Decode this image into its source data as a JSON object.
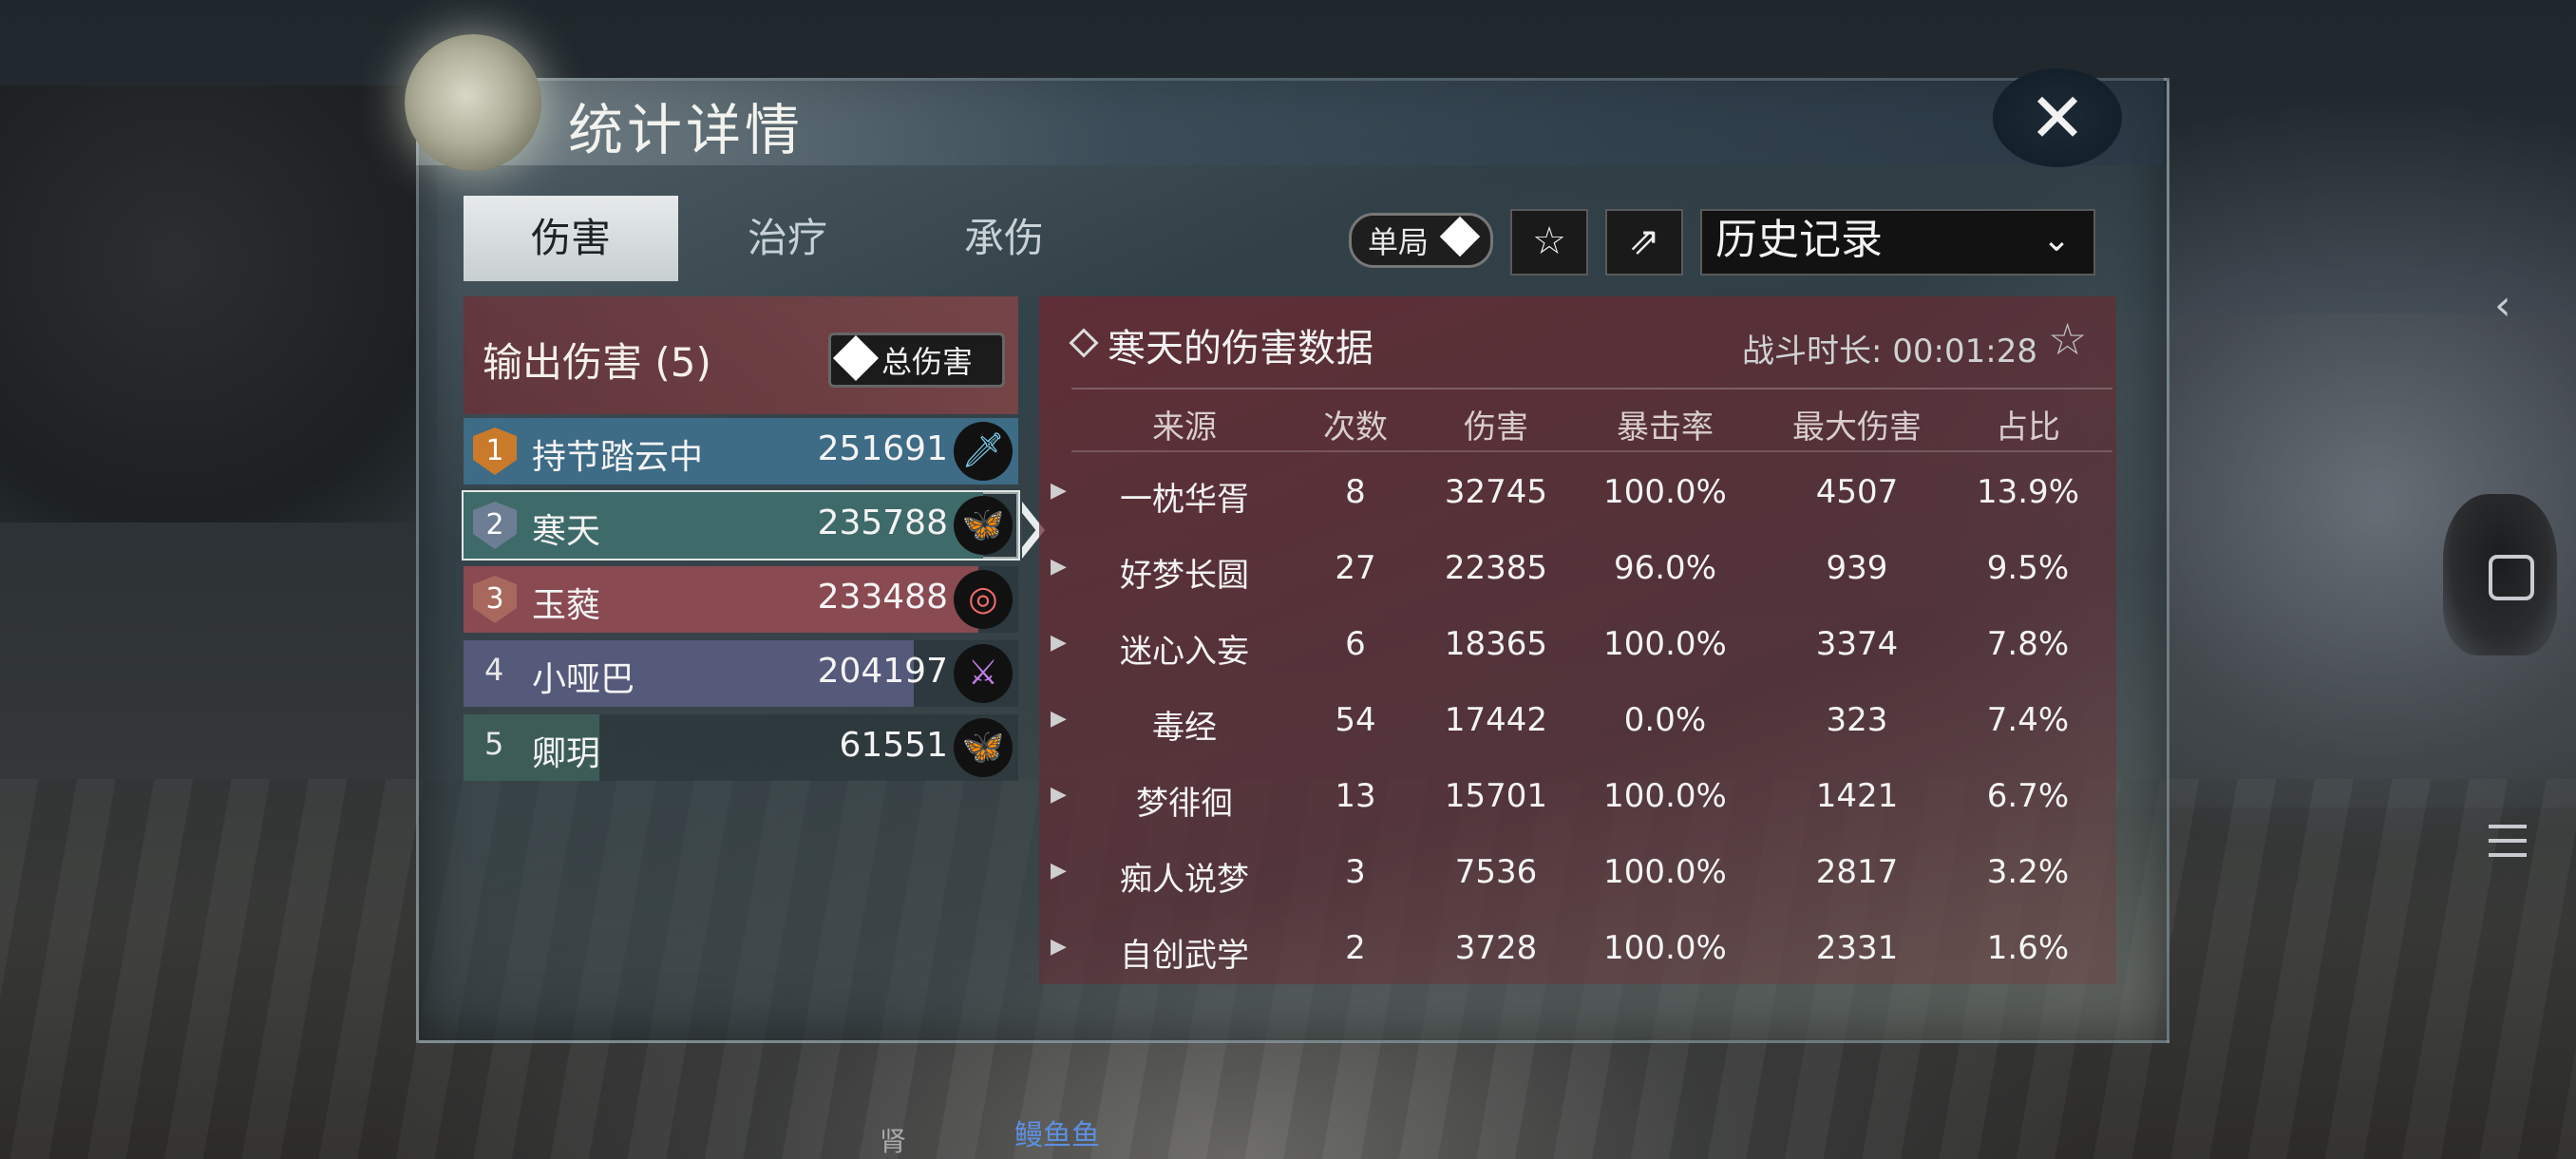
{
  "dialog": {
    "title": "统计详情",
    "close_icon": "✕"
  },
  "tabs": [
    {
      "label": "伤害",
      "active": true
    },
    {
      "label": "治疗",
      "active": false
    },
    {
      "label": "承伤",
      "active": false
    }
  ],
  "toolbar": {
    "mode_label": "单局",
    "history_label": "历史记录"
  },
  "ranking": {
    "title": "输出伤害 (5)",
    "filter_label": "总伤害",
    "rows": [
      {
        "rank": "1",
        "name": "持节踏云中",
        "value": "251691",
        "share": 1.0,
        "fill": "#3e6b86",
        "medal": "#c97a2b",
        "icon": "sword-icon",
        "icon_color": "#7fd0f0",
        "selected": false
      },
      {
        "rank": "2",
        "name": "寒天",
        "value": "235788",
        "share": 0.937,
        "fill": "#3f6a6a",
        "medal": "#6d7e94",
        "icon": "butterfly-icon",
        "icon_color": "#7fe0d0",
        "selected": true
      },
      {
        "rank": "3",
        "name": "玉蕤",
        "value": "233488",
        "share": 0.928,
        "fill": "#8a4a52",
        "medal": "#a8685e",
        "icon": "target-icon",
        "icon_color": "#f06a6a",
        "selected": false
      },
      {
        "rank": "4",
        "name": "小哑巴",
        "value": "204197",
        "share": 0.811,
        "fill": "#55597a",
        "medal": "",
        "icon": "crossed-blades-icon",
        "icon_color": "#c07de8",
        "selected": false
      },
      {
        "rank": "5",
        "name": "卿玥",
        "value": "61551",
        "share": 0.245,
        "fill": "#3d5c58",
        "medal": "",
        "icon": "butterfly-icon",
        "icon_color": "#7fe0d0",
        "selected": false
      }
    ]
  },
  "detail": {
    "title": "寒天的伤害数据",
    "duration": "战斗时长: 00:01:28",
    "columns": [
      "来源",
      "次数",
      "伤害",
      "暴击率",
      "最大伤害",
      "占比"
    ],
    "rows": [
      [
        "一枕华胥",
        "8",
        "32745",
        "100.0%",
        "4507",
        "13.9%"
      ],
      [
        "好梦长圆",
        "27",
        "22385",
        "96.0%",
        "939",
        "9.5%"
      ],
      [
        "迷心入妄",
        "6",
        "18365",
        "100.0%",
        "3374",
        "7.8%"
      ],
      [
        "毒经",
        "54",
        "17442",
        "0.0%",
        "323",
        "7.4%"
      ],
      [
        "梦徘徊",
        "13",
        "15701",
        "100.0%",
        "1421",
        "6.7%"
      ],
      [
        "痴人说梦",
        "3",
        "7536",
        "100.0%",
        "2817",
        "3.2%"
      ],
      [
        "自创武学",
        "2",
        "3728",
        "100.0%",
        "2331",
        "1.6%"
      ]
    ]
  },
  "background": {
    "label_1": "鳗鱼鱼",
    "label_2": "肾"
  }
}
